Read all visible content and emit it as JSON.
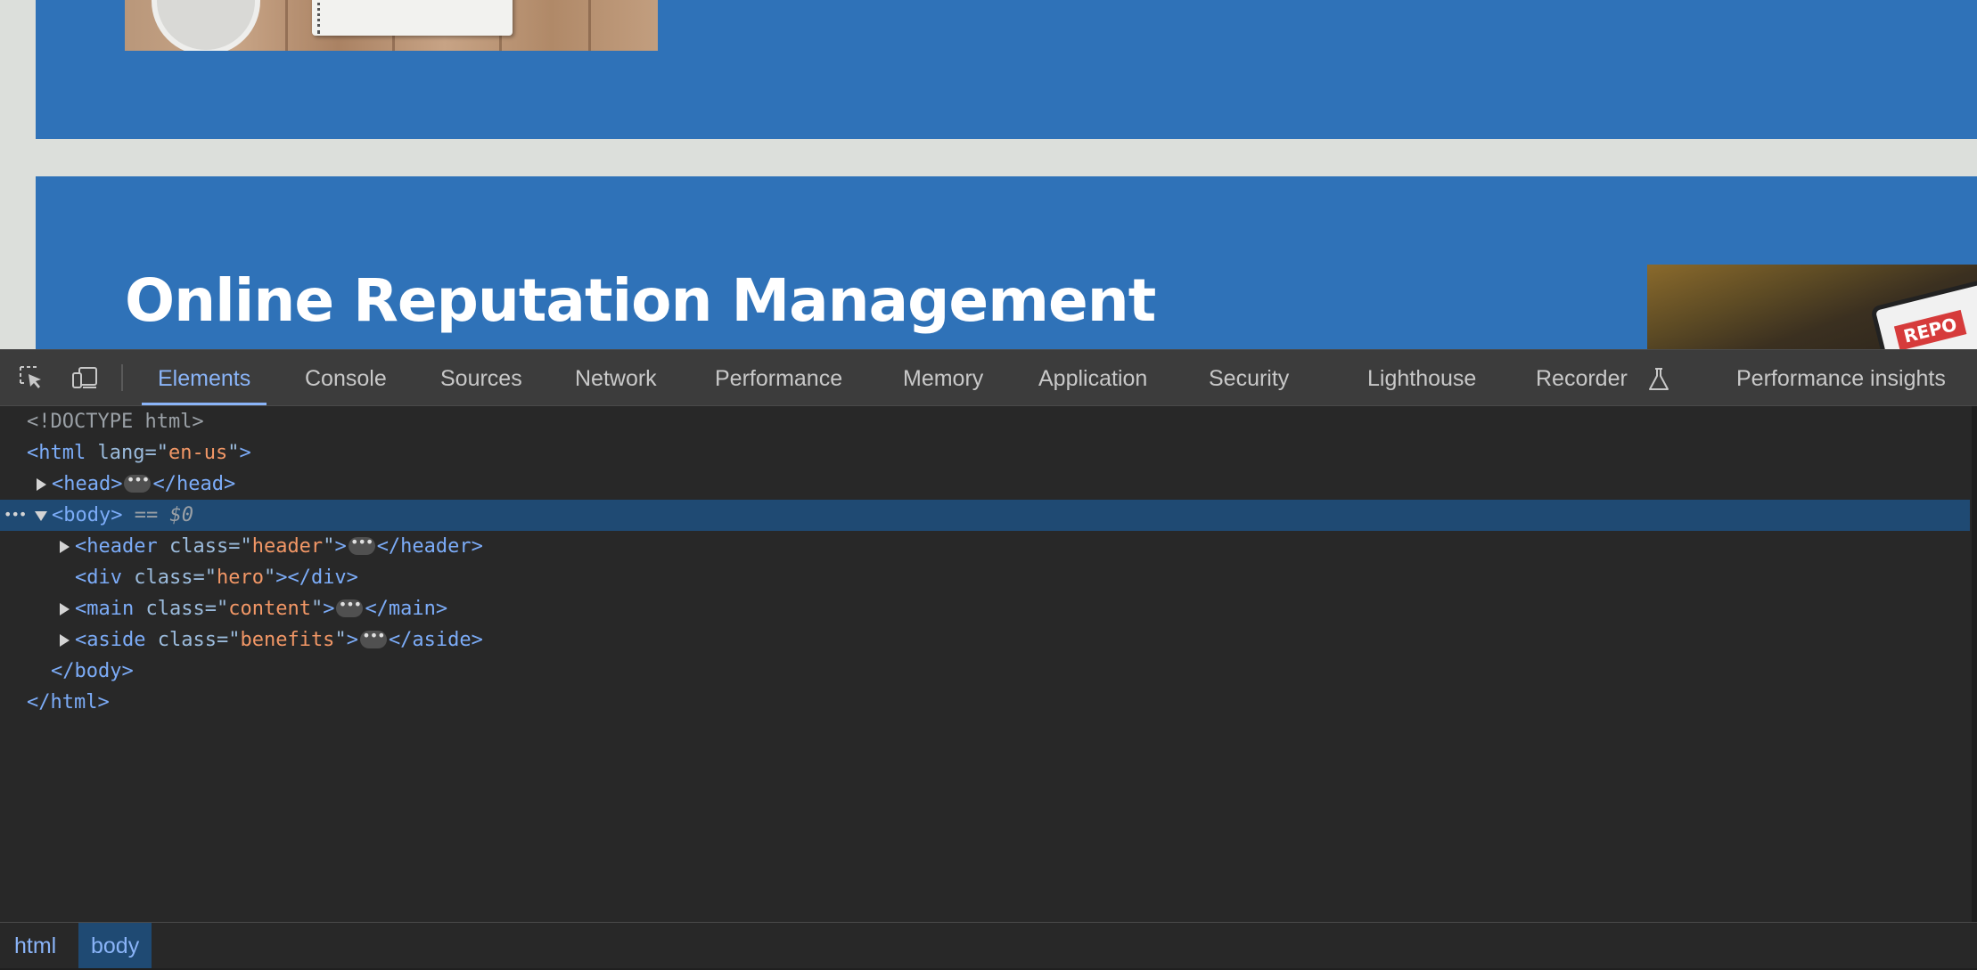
{
  "page": {
    "hero_title": "Online Reputation Management",
    "report_text": "REPO",
    "colors": {
      "section_blue": "#2f72b8",
      "page_bg": "#dcdfdb"
    }
  },
  "devtools": {
    "toolbar": {
      "icons": [
        "inspect-element-icon",
        "device-toolbar-icon",
        "flask-icon"
      ],
      "tabs": [
        {
          "label": "Elements",
          "active": true
        },
        {
          "label": "Console"
        },
        {
          "label": "Sources"
        },
        {
          "label": "Network"
        },
        {
          "label": "Performance"
        },
        {
          "label": "Memory"
        },
        {
          "label": "Application"
        },
        {
          "label": "Security"
        },
        {
          "label": "Lighthouse"
        },
        {
          "label": "Recorder"
        },
        {
          "label": "Performance insights"
        }
      ]
    },
    "dom": {
      "doctype": "<!DOCTYPE html>",
      "html_open": "<html",
      "lang_attr": "lang",
      "lang_value": "en-us",
      "close_bracket": ">",
      "head_open": "<head>",
      "head_close": "</head>",
      "body_open": "<body>",
      "body_selected_marker": "== $0",
      "header_open": "<header",
      "header_close": "</header>",
      "div_open": "<div",
      "div_close": "></div>",
      "main_open": "<main",
      "main_close": "</main>",
      "aside_open": "<aside",
      "aside_close": "</aside>",
      "class_attr": "class",
      "header_class": "header",
      "hero_class": "hero",
      "content_class": "content",
      "benefits_class": "benefits",
      "body_close": "</body>",
      "html_close": "</html>"
    },
    "breadcrumb": [
      {
        "label": "html"
      },
      {
        "label": "body",
        "active": true
      }
    ],
    "colors": {
      "accent": "#8ab4f8",
      "selection": "#1f4a73",
      "attr_value": "#f29766",
      "tag": "#7cacf8"
    }
  }
}
